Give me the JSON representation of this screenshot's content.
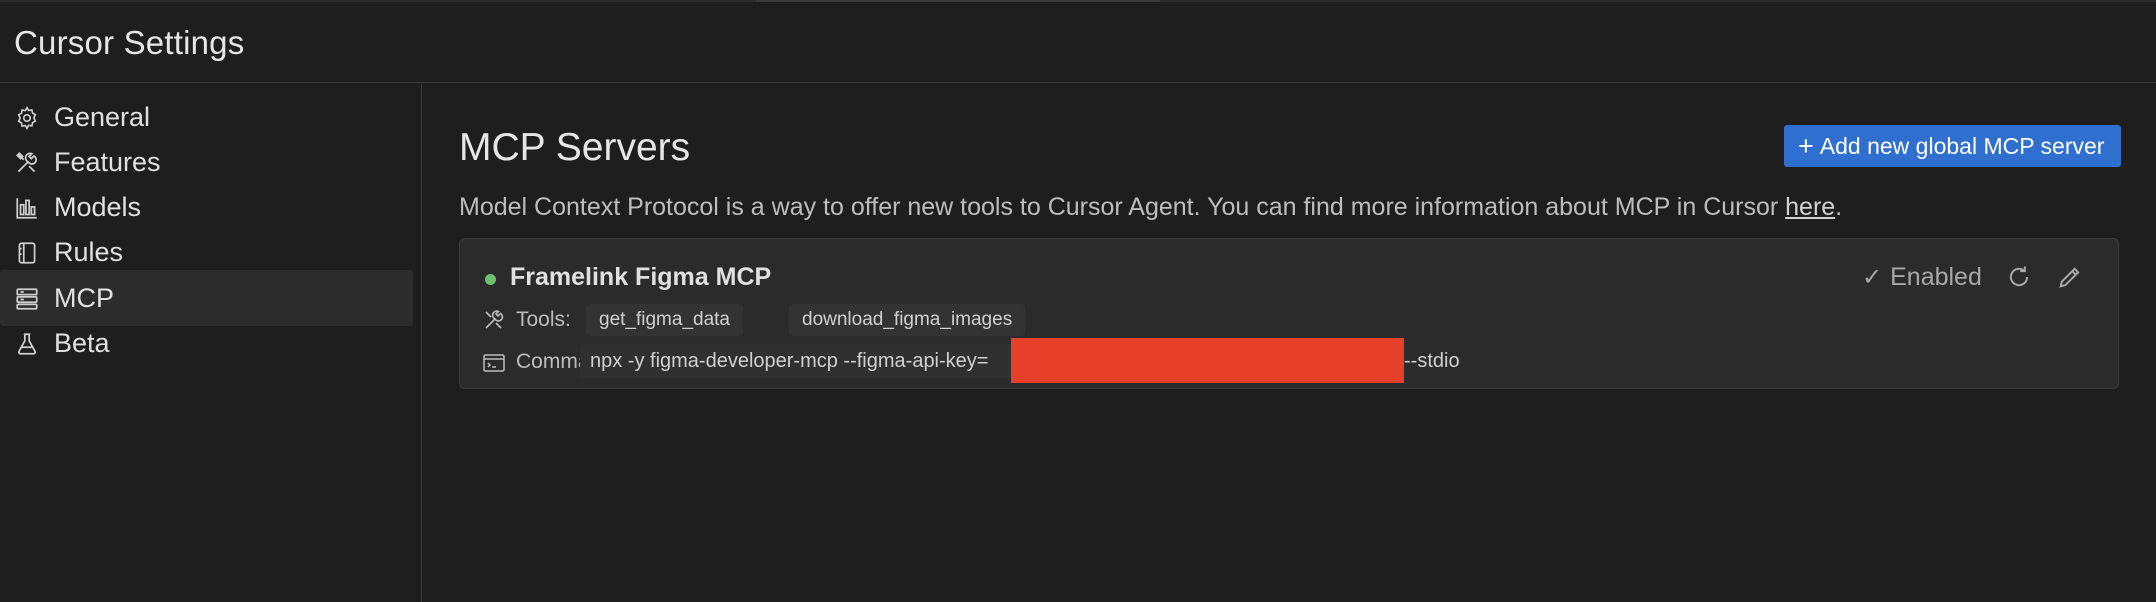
{
  "window": {
    "title": "Cursor Settings"
  },
  "sidebar": {
    "items": [
      {
        "label": "General",
        "icon": "gear-icon",
        "active": false
      },
      {
        "label": "Features",
        "icon": "tools-icon",
        "active": false
      },
      {
        "label": "Models",
        "icon": "bar-chart-icon",
        "active": false
      },
      {
        "label": "Rules",
        "icon": "book-icon",
        "active": false
      },
      {
        "label": "MCP",
        "icon": "server-icon",
        "active": true
      },
      {
        "label": "Beta",
        "icon": "flask-icon",
        "active": false
      }
    ]
  },
  "main": {
    "title": "MCP Servers",
    "add_button": {
      "icon": "plus-icon",
      "label": "Add new global MCP server"
    },
    "description": {
      "text": "Model Context Protocol is a way to offer new tools to Cursor Agent. You can find more information about MCP in Cursor ",
      "link": "here",
      "suffix": "."
    },
    "servers": [
      {
        "name": "Framelink Figma MCP",
        "status_color": "#6cc070",
        "enabled_label": "Enabled",
        "tools_label": "Tools:",
        "tools": [
          "get_figma_data",
          "download_figma_images"
        ],
        "command_label": "Command:",
        "command_prefix": "npx -y figma-developer-mcp --figma-api-key=",
        "command_suffix": "--stdio",
        "redaction_color": "#e63f2a"
      }
    ]
  },
  "colors": {
    "accent": "#2f6fd0",
    "background": "#1e1e1e",
    "card": "#2b2b2b"
  }
}
